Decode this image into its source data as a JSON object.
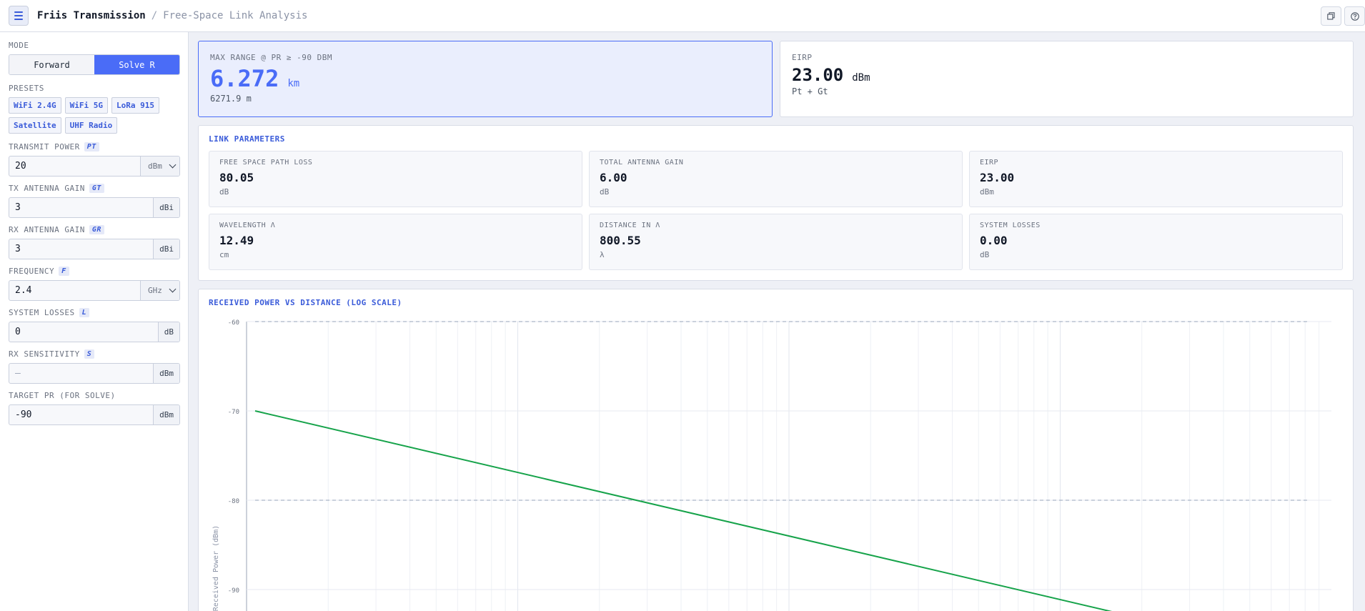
{
  "header": {
    "title": "Friis Transmission",
    "separator": "/",
    "subtitle": "Free-Space Link Analysis",
    "icons": [
      "menu-icon",
      "copy-icon",
      "help-icon"
    ]
  },
  "sidebar": {
    "mode_label": "MODE",
    "mode_options": [
      "Forward",
      "Solve R"
    ],
    "mode_selected": "Solve R",
    "presets_label": "PRESETS",
    "presets": [
      "WiFi 2.4G",
      "WiFi 5G",
      "LoRa 915",
      "Satellite",
      "UHF Radio"
    ],
    "fields": [
      {
        "label": "TRANSMIT POWER",
        "symbol": "PT",
        "value": "20",
        "placeholder": "",
        "unit": "dBm",
        "select": true
      },
      {
        "label": "TX ANTENNA GAIN",
        "symbol": "GT",
        "value": "3",
        "placeholder": "",
        "unit": "dBi",
        "select": false
      },
      {
        "label": "RX ANTENNA GAIN",
        "symbol": "GR",
        "value": "3",
        "placeholder": "",
        "unit": "dBi",
        "select": false
      },
      {
        "label": "FREQUENCY",
        "symbol": "F",
        "value": "2.4",
        "placeholder": "",
        "unit": "GHz",
        "select": true
      },
      {
        "label": "SYSTEM LOSSES",
        "symbol": "L",
        "value": "0",
        "placeholder": "",
        "unit": "dB",
        "select": false
      },
      {
        "label": "RX SENSITIVITY",
        "symbol": "S",
        "value": "",
        "placeholder": "—",
        "unit": "dBm",
        "select": false
      },
      {
        "label": "TARGET PR (FOR SOLVE)",
        "symbol": "",
        "value": "-90",
        "placeholder": "",
        "unit": "dBm",
        "select": false
      }
    ]
  },
  "kpi_main": {
    "label": "MAX RANGE @ PR ≥ -90 DBM",
    "value": "6.272",
    "unit": "km",
    "sub": "6271.9 m"
  },
  "kpi_eirp": {
    "label": "EIRP",
    "value": "23.00",
    "unit": "dBm",
    "sub": "Pt + Gt"
  },
  "params": {
    "title": "LINK PARAMETERS",
    "items": [
      {
        "label": "FREE SPACE PATH LOSS",
        "value": "80.05",
        "unit": "dB"
      },
      {
        "label": "TOTAL ANTENNA GAIN",
        "value": "6.00",
        "unit": "dB"
      },
      {
        "label": "EIRP",
        "value": "23.00",
        "unit": "dBm"
      },
      {
        "label": "WAVELENGTH λ",
        "value": "12.49",
        "unit": "cm"
      },
      {
        "label": "DISTANCE IN λ",
        "value": "800.55",
        "unit": "λ"
      },
      {
        "label": "SYSTEM LOSSES",
        "value": "0.00",
        "unit": "dB"
      }
    ]
  },
  "colors": {
    "accent": "#4a6cf7",
    "line": "#16a34a",
    "ref_line": "#94a3b8"
  },
  "chart_data": {
    "type": "line",
    "title": "RECEIVED POWER VS DISTANCE (LOG SCALE)",
    "xlabel": "",
    "ylabel": "Received Power (dBm)",
    "x_scale": "log",
    "y_ticks": [
      -60,
      -70,
      -80,
      -90
    ],
    "ylim": [
      -94,
      -60
    ],
    "reference_lines": [
      -60,
      -80
    ],
    "grid": true,
    "series": [
      {
        "name": "",
        "color": "#16a34a",
        "points": [
          [
            0.0,
            -70.0
          ],
          [
            0.85,
            -94.0
          ]
        ]
      }
    ]
  }
}
